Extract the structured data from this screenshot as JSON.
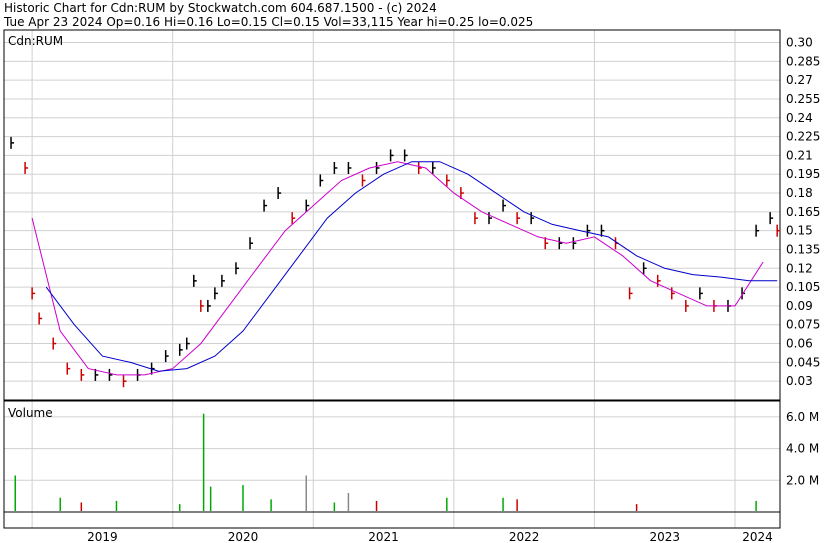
{
  "header": {
    "line1": "Historic Chart for Cdn:RUM by Stockwatch.com 604.687.1500 - (c) 2024",
    "line2": "Tue Apr 23 2024  Op=0.16  Hi=0.16  Lo=0.15  Cl=0.15  Vol=33,115  Year hi=0.25  lo=0.025"
  },
  "chart_data": [
    {
      "type": "ohlc",
      "panel_label": "Cdn:RUM",
      "y_ticks": [
        "0.30",
        "0.285",
        "0.27",
        "0.255",
        "0.24",
        "0.225",
        "0.21",
        "0.195",
        "0.18",
        "0.165",
        "0.15",
        "0.135",
        "0.12",
        "0.105",
        "0.09",
        "0.075",
        "0.06",
        "0.045",
        "0.03"
      ],
      "ylim": [
        0.015,
        0.31
      ],
      "x_labels": [
        "2019",
        "2020",
        "2021",
        "2022",
        "2023",
        "2024"
      ],
      "grid": true,
      "colors": {
        "up": "#000000",
        "down": "#cc0000",
        "ma_fast": "#cc00cc",
        "ma_slow": "#0000cc",
        "grid": "#d0d0d0"
      },
      "series": [
        {
          "name": "price",
          "x": [
            2018.85,
            2018.95,
            2019.0,
            2019.05,
            2019.15,
            2019.25,
            2019.35,
            2019.45,
            2019.55,
            2019.65,
            2019.75,
            2019.85,
            2019.95,
            2020.05,
            2020.1,
            2020.15,
            2020.2,
            2020.25,
            2020.3,
            2020.35,
            2020.45,
            2020.55,
            2020.65,
            2020.75,
            2020.85,
            2020.95,
            2021.05,
            2021.15,
            2021.25,
            2021.35,
            2021.45,
            2021.55,
            2021.65,
            2021.75,
            2021.85,
            2021.95,
            2022.05,
            2022.15,
            2022.25,
            2022.35,
            2022.45,
            2022.55,
            2022.65,
            2022.75,
            2022.85,
            2022.95,
            2023.05,
            2023.15,
            2023.25,
            2023.35,
            2023.45,
            2023.55,
            2023.65,
            2023.75,
            2023.85,
            2023.95,
            2024.05,
            2024.15,
            2024.25,
            2024.3
          ],
          "y": [
            0.22,
            0.2,
            0.1,
            0.08,
            0.06,
            0.04,
            0.035,
            0.035,
            0.035,
            0.03,
            0.035,
            0.04,
            0.05,
            0.055,
            0.06,
            0.11,
            0.09,
            0.09,
            0.1,
            0.11,
            0.12,
            0.14,
            0.17,
            0.18,
            0.16,
            0.17,
            0.19,
            0.2,
            0.2,
            0.19,
            0.2,
            0.21,
            0.21,
            0.2,
            0.2,
            0.19,
            0.18,
            0.16,
            0.16,
            0.17,
            0.16,
            0.16,
            0.14,
            0.14,
            0.14,
            0.15,
            0.15,
            0.14,
            0.1,
            0.12,
            0.11,
            0.1,
            0.09,
            0.1,
            0.09,
            0.09,
            0.1,
            0.15,
            0.16,
            0.15
          ]
        },
        {
          "name": "",
          "x": [
            2019.0,
            2019.2,
            2019.4,
            2019.6,
            2019.8,
            2020.0,
            2020.2,
            2020.4,
            2020.6,
            2020.8,
            2021.0,
            2021.2,
            2021.4,
            2021.6,
            2021.8,
            2022.0,
            2022.2,
            2022.4,
            2022.6,
            2022.8,
            2023.0,
            2023.2,
            2023.4,
            2023.6,
            2023.8,
            2024.0,
            2024.2
          ],
          "y": [
            0.16,
            0.07,
            0.04,
            0.035,
            0.035,
            0.04,
            0.06,
            0.09,
            0.12,
            0.15,
            0.17,
            0.19,
            0.2,
            0.205,
            0.2,
            0.18,
            0.165,
            0.155,
            0.145,
            0.14,
            0.145,
            0.13,
            0.11,
            0.1,
            0.09,
            0.09,
            0.125
          ]
        },
        {
          "name": "",
          "x": [
            2019.1,
            2019.3,
            2019.5,
            2019.7,
            2019.9,
            2020.1,
            2020.3,
            2020.5,
            2020.7,
            2020.9,
            2021.1,
            2021.3,
            2021.5,
            2021.7,
            2021.9,
            2022.1,
            2022.3,
            2022.5,
            2022.7,
            2022.9,
            2023.1,
            2023.3,
            2023.5,
            2023.7,
            2023.9,
            2024.1,
            2024.3
          ],
          "y": [
            0.105,
            0.075,
            0.05,
            0.045,
            0.038,
            0.04,
            0.05,
            0.07,
            0.1,
            0.13,
            0.16,
            0.18,
            0.195,
            0.205,
            0.205,
            0.195,
            0.18,
            0.165,
            0.155,
            0.15,
            0.145,
            0.13,
            0.12,
            0.115,
            0.113,
            0.11,
            0.11
          ]
        }
      ]
    },
    {
      "type": "bar",
      "panel_label": "Volume",
      "y_ticks": [
        "6.0 M",
        "4.0 M",
        "2.0 M"
      ],
      "ylim": [
        0,
        7000000
      ],
      "colors": {
        "up": "#00aa00",
        "down": "#cc0000",
        "neutral": "#888888"
      },
      "bars": [
        {
          "x": 2018.88,
          "v": 2300000,
          "c": "up"
        },
        {
          "x": 2019.2,
          "v": 900000,
          "c": "up"
        },
        {
          "x": 2019.35,
          "v": 600000,
          "c": "down"
        },
        {
          "x": 2019.6,
          "v": 700000,
          "c": "up"
        },
        {
          "x": 2020.05,
          "v": 500000,
          "c": "up"
        },
        {
          "x": 2020.22,
          "v": 6200000,
          "c": "up"
        },
        {
          "x": 2020.27,
          "v": 1600000,
          "c": "up"
        },
        {
          "x": 2020.5,
          "v": 1700000,
          "c": "up"
        },
        {
          "x": 2020.7,
          "v": 800000,
          "c": "up"
        },
        {
          "x": 2020.95,
          "v": 2300000,
          "c": "neutral"
        },
        {
          "x": 2021.15,
          "v": 600000,
          "c": "up"
        },
        {
          "x": 2021.25,
          "v": 1200000,
          "c": "neutral"
        },
        {
          "x": 2021.45,
          "v": 700000,
          "c": "down"
        },
        {
          "x": 2021.95,
          "v": 900000,
          "c": "up"
        },
        {
          "x": 2022.35,
          "v": 900000,
          "c": "up"
        },
        {
          "x": 2022.45,
          "v": 800000,
          "c": "down"
        },
        {
          "x": 2023.3,
          "v": 500000,
          "c": "down"
        },
        {
          "x": 2024.15,
          "v": 700000,
          "c": "up"
        }
      ]
    }
  ]
}
